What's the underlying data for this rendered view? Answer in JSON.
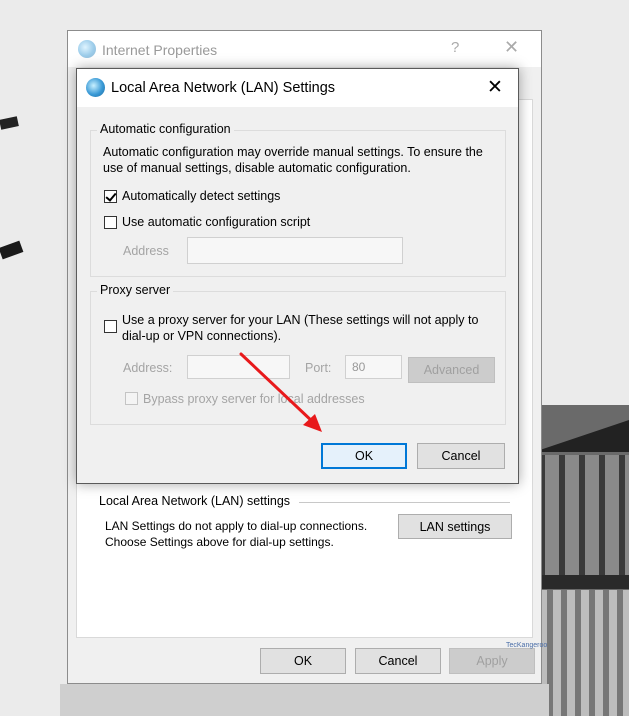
{
  "parent_window": {
    "title": "Internet Properties",
    "help_glyph": "?",
    "close_glyph": "✕",
    "lan_section_header": "Local Area Network (LAN) settings",
    "lan_section_description": "LAN Settings do not apply to dial-up connections. Choose Settings above for dial-up settings.",
    "lan_settings_button": "LAN settings",
    "buttons": {
      "ok": "OK",
      "cancel": "Cancel",
      "apply": "Apply"
    }
  },
  "lan_dialog": {
    "title": "Local Area Network (LAN) Settings",
    "close_glyph": "✕",
    "auto_config": {
      "legend": "Automatic configuration",
      "description": "Automatic configuration may override manual settings.  To ensure the use of manual settings, disable automatic configuration.",
      "auto_detect_label": "Automatically detect settings",
      "auto_detect_checked": true,
      "script_label": "Use automatic configuration script",
      "script_checked": false,
      "address_label": "Address",
      "address_value": ""
    },
    "proxy": {
      "legend": "Proxy server",
      "use_proxy_label": "Use a proxy server for your LAN (These settings will not apply to dial-up or VPN connections).",
      "use_proxy_checked": false,
      "address_label": "Address:",
      "address_value": "",
      "port_label": "Port:",
      "port_value": "80",
      "advanced_button": "Advanced",
      "bypass_label": "Bypass proxy server for local addresses",
      "bypass_checked": false
    },
    "buttons": {
      "ok": "OK",
      "cancel": "Cancel"
    }
  },
  "watermark": "TecKangeroo",
  "annotation": {
    "arrow_color": "#e8191b",
    "points_to": "ok-button"
  },
  "colors": {
    "focus_border": "#0078d7",
    "dialog_bg": "#f0f0f0"
  },
  "icons": {
    "app_icon": "globe-network-icon",
    "close": "close-icon",
    "help": "help-icon"
  }
}
